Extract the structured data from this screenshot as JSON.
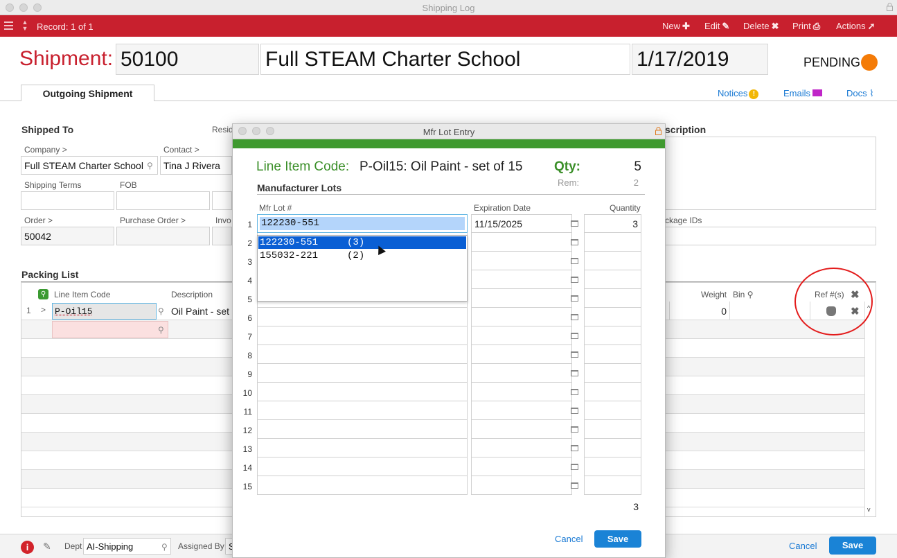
{
  "window": {
    "title": "Shipping Log"
  },
  "toolbar": {
    "record": "Record: 1 of 1",
    "new": "New",
    "edit": "Edit",
    "delete": "Delete",
    "print": "Print",
    "actions": "Actions"
  },
  "header": {
    "label": "Shipment:",
    "number": "50100",
    "company": "Full STEAM Charter School",
    "date": "1/17/2019",
    "status": "PENDING",
    "status_color": "#f47b07"
  },
  "tabs": {
    "outgoing": "Outgoing Shipment"
  },
  "links": {
    "notices": "Notices",
    "emails": "Emails",
    "docs": "Docs"
  },
  "form": {
    "shipped_to": "Shipped To",
    "resid_partial": "Resid",
    "description_partial": "scription",
    "company_label": "Company >",
    "company_value": "Full STEAM Charter School",
    "contact_label": "Contact >",
    "contact_value": "Tina J Rivera",
    "shipping_terms_label": "Shipping Terms",
    "fob_label": "FOB",
    "order_label": "Order >",
    "order_value": "50042",
    "po_label": "Purchase Order >",
    "invoice_partial": "Invo",
    "package_ids_partial": "ckage IDs"
  },
  "packing": {
    "title": "Packing List",
    "col_line_item": "Line Item Code",
    "col_description": "Description",
    "col_weight": "Weight",
    "col_bin": "Bin",
    "col_ref": "Ref #(s)",
    "row1": {
      "num": "1",
      "code": "P-Oil15",
      "description": "Oil Paint - set",
      "weight": "0"
    }
  },
  "bottom": {
    "dept_label": "Dept",
    "dept_value": "AI-Shipping",
    "assigned_label": "Assigned By",
    "assigned_partial": "S",
    "cancel": "Cancel",
    "save": "Save"
  },
  "modal": {
    "title": "Mfr Lot Entry",
    "line_item_label": "Line Item Code:",
    "line_item_value": "P-Oil15: Oil Paint - set of 15",
    "qty_label": "Qty:",
    "qty_value": "5",
    "rem_label": "Rem:",
    "rem_value": "2",
    "section": "Manufacturer Lots",
    "col_lot": "Mfr Lot #",
    "col_exp": "Expiration Date",
    "col_qty": "Quantity",
    "rows": [
      {
        "num": "1",
        "lot": "122230-551",
        "exp": "11/15/2025",
        "qty": "3"
      },
      {
        "num": "2"
      },
      {
        "num": "3"
      },
      {
        "num": "4"
      },
      {
        "num": "5"
      },
      {
        "num": "6"
      },
      {
        "num": "7"
      },
      {
        "num": "8"
      },
      {
        "num": "9"
      },
      {
        "num": "10"
      },
      {
        "num": "11"
      },
      {
        "num": "12"
      },
      {
        "num": "13"
      },
      {
        "num": "14"
      },
      {
        "num": "15"
      }
    ],
    "dropdown": [
      {
        "text": "122230-551     (3)"
      },
      {
        "text": "155032-221     (2)"
      }
    ],
    "total": "3",
    "cancel": "Cancel",
    "save": "Save"
  }
}
